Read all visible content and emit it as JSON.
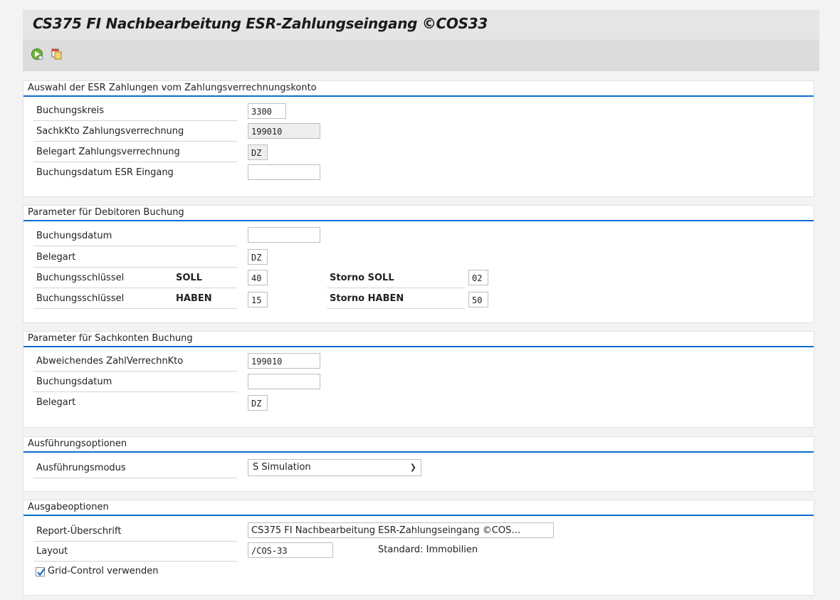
{
  "window": {
    "title": "CS375 FI Nachbearbeitung ESR-Zahlungseingang ©COS33"
  },
  "toolbar": {
    "icons": [
      "execute-icon",
      "variant-icon"
    ]
  },
  "section1": {
    "title": "Auswahl der ESR Zahlungen vom Zahlungsverrechnungskonto",
    "buchungskreis": {
      "label": "Buchungskreis",
      "value": "3300"
    },
    "sachkkto": {
      "label": "SachkKto Zahlungsverrechnung",
      "value": "199010"
    },
    "belegart": {
      "label": "Belegart Zahlungsverrechnung",
      "value": "DZ"
    },
    "buchungsdatum": {
      "label": "Buchungsdatum ESR Eingang",
      "value": ""
    }
  },
  "section2": {
    "title": "Parameter für Debitoren Buchung",
    "buchungsdatum": {
      "label": "Buchungsdatum",
      "value": ""
    },
    "belegart": {
      "label": "Belegart",
      "value": "DZ"
    },
    "bs_soll": {
      "label": "Buchungsschlüssel",
      "sublabel": "SOLL",
      "value": "40",
      "storno_label": "Storno SOLL",
      "storno_value": "02"
    },
    "bs_haben": {
      "label": "Buchungsschlüssel",
      "sublabel": "HABEN",
      "value": "15",
      "storno_label": "Storno HABEN",
      "storno_value": "50"
    }
  },
  "section3": {
    "title": "Parameter für Sachkonten Buchung",
    "konto": {
      "label": "Abweichendes ZahlVerrechnKto",
      "value": "199010"
    },
    "buchungsdatum": {
      "label": "Buchungsdatum",
      "value": ""
    },
    "belegart": {
      "label": "Belegart",
      "value": "DZ"
    }
  },
  "section4": {
    "title": "Ausführungsoptionen",
    "modus": {
      "label": "Ausführungsmodus",
      "value": "S Simulation"
    }
  },
  "section5": {
    "title": "Ausgabeoptionen",
    "report": {
      "label": "Report-Überschrift",
      "value": "CS375 FI Nachbearbeitung ESR-Zahlungseingang ©COS…"
    },
    "layout": {
      "label": "Layout",
      "value": "/COS-33",
      "description": "Standard: Immobilien"
    },
    "grid": {
      "label": "Grid-Control verwenden",
      "checked": true
    }
  },
  "colors": {
    "accent": "#0a6ed1",
    "check": "#1a73c7"
  }
}
